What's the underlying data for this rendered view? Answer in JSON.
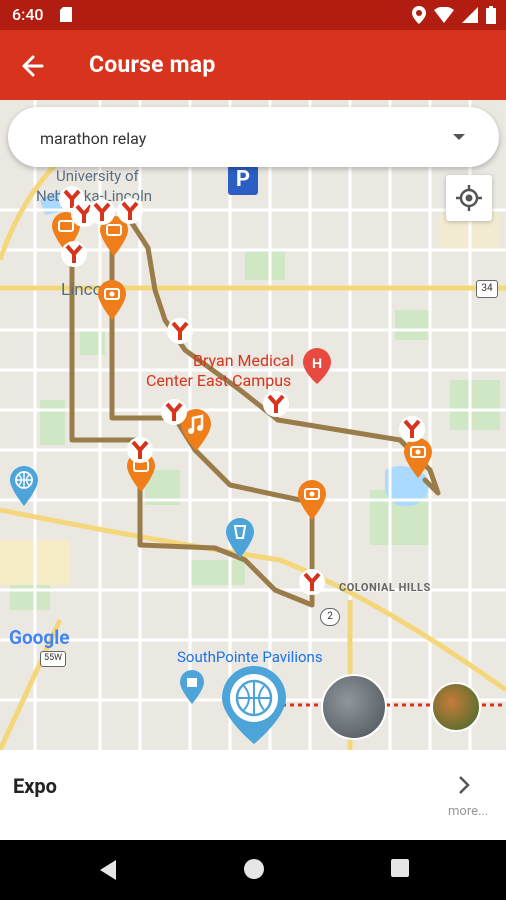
{
  "status_bar": {
    "time": "6:40"
  },
  "app_bar": {
    "title": "Course map",
    "back_icon": "arrow-back-icon"
  },
  "course_selector": {
    "selected": "marathon relay"
  },
  "map": {
    "labels": {
      "university": "University of",
      "nebraska": "Nebraska-Lincoln",
      "lincoln": "Lincoln",
      "bryan_1": "Bryan Medical",
      "bryan_2": "Center East Campus",
      "colonial": "COLONIAL HILLS",
      "southpointe": "SouthPointe Pavilions",
      "route_34": "34",
      "route_2": "2",
      "route_55w": "55W",
      "google": "Google"
    },
    "colors": {
      "route": "#9a7c4a",
      "pin_orange": "#ef7d1a",
      "marker_red": "#d8331c",
      "globe_blue": "#4da4d8"
    }
  },
  "bottom_sheet": {
    "title": "Expo",
    "more": "more..."
  }
}
